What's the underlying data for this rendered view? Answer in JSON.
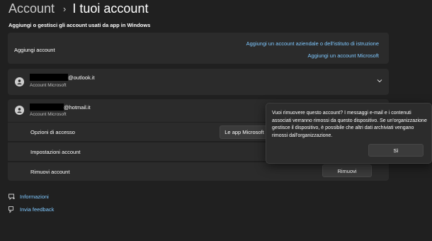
{
  "header": {
    "root": "Account",
    "separator": "›",
    "current": "I tuoi account",
    "subtitle": "Aggiungi o gestisci gli account usati da app in Windows"
  },
  "add_account": {
    "label": "Aggiungi account",
    "work_link": "Aggiungi un account aziendale o dell'istituto di istruzione",
    "microsoft_link": "Aggiungi un account Microsoft"
  },
  "accounts": [
    {
      "email_suffix": "@outlook.it",
      "type": "Account Microsoft",
      "expanded": false
    },
    {
      "email_suffix": "@hotmail.it",
      "type": "Account Microsoft",
      "expanded": true
    }
  ],
  "account_options": {
    "access_label": "Opzioni di accesso",
    "access_button": "Le app Microsoft",
    "settings_label": "Impostazioni account",
    "remove_label": "Rimuovi account",
    "remove_button": "Rimuovi"
  },
  "dialog": {
    "message": "Vuoi rimuovere questo account? I messaggi e-mail e i contenuti associati verranno rimossi da questo dispositivo. Se un'organizzazione gestisce il dispositivo, è possibile che altri dati archiviati vengano rimossi dall'organizzazione.",
    "confirm": "Sì"
  },
  "footer": {
    "info": "Informazioni",
    "feedback": "Invia feedback"
  },
  "icons": [
    "person-icon",
    "chevron-down-icon",
    "info-icon",
    "feedback-icon"
  ],
  "colors": {
    "background": "#202020",
    "card": "#2b2b2b",
    "link": "#7fc8ff",
    "redaction": "#000000"
  }
}
